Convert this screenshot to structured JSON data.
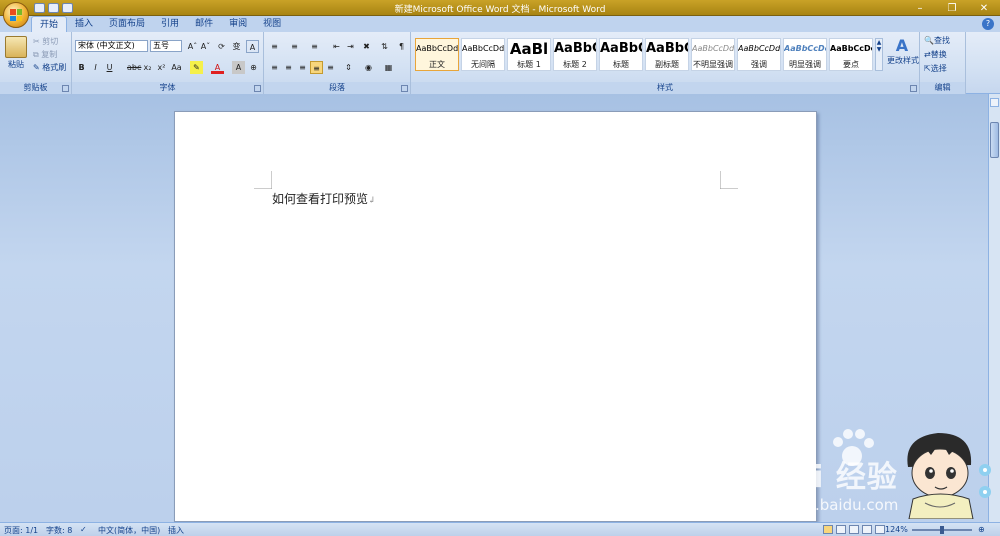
{
  "window": {
    "title": "新建Microsoft Office Word 文档 - Microsoft Word"
  },
  "tabs": [
    "开始",
    "插入",
    "页面布局",
    "引用",
    "邮件",
    "审阅",
    "视图"
  ],
  "clipboard": {
    "paste": "粘贴",
    "cut": "剪切",
    "copy": "复制",
    "format_painter": "格式刷",
    "label": "剪贴板"
  },
  "font": {
    "name": "宋体 (中文正文)",
    "size": "五号",
    "label": "字体"
  },
  "paragraph": {
    "label": "段落"
  },
  "styles": {
    "label": "样式",
    "items": [
      {
        "sample": "AaBbCcDd",
        "name": "正文"
      },
      {
        "sample": "AaBbCcDd",
        "name": "无间隔"
      },
      {
        "sample": "AaBl",
        "name": "标题 1"
      },
      {
        "sample": "AaBbC",
        "name": "标题 2"
      },
      {
        "sample": "AaBbC",
        "name": "标题"
      },
      {
        "sample": "AaBbC",
        "name": "副标题"
      },
      {
        "sample": "AaBbCcDd",
        "name": "不明显强调"
      },
      {
        "sample": "AaBbCcDd",
        "name": "强调"
      },
      {
        "sample": "AaBbCcDc",
        "name": "明显强调"
      },
      {
        "sample": "AaBbCcDc",
        "name": "要点"
      }
    ],
    "change": "更改样式"
  },
  "editing": {
    "find": "查找",
    "replace": "替换",
    "select": "选择",
    "label": "编辑"
  },
  "document": {
    "text": "如何查看打印预览"
  },
  "status": {
    "page": "页面: 1/1",
    "words": "字数: 8",
    "language": "中文(简体，中国)",
    "mode": "插入",
    "zoom": "124%"
  },
  "watermark": {
    "text": "Bai 经验",
    "url": "jingyan.baidu.com"
  },
  "colors": {
    "accent": "#15428b",
    "title_bar": "#b8921c",
    "ribbon": "#d3e1f3",
    "doc_bg": "#b7cdea"
  },
  "icons": [
    "office-button-icon",
    "save-icon",
    "undo-icon",
    "redo-icon",
    "minimize-icon",
    "maximize-icon",
    "close-icon",
    "help-icon"
  ]
}
